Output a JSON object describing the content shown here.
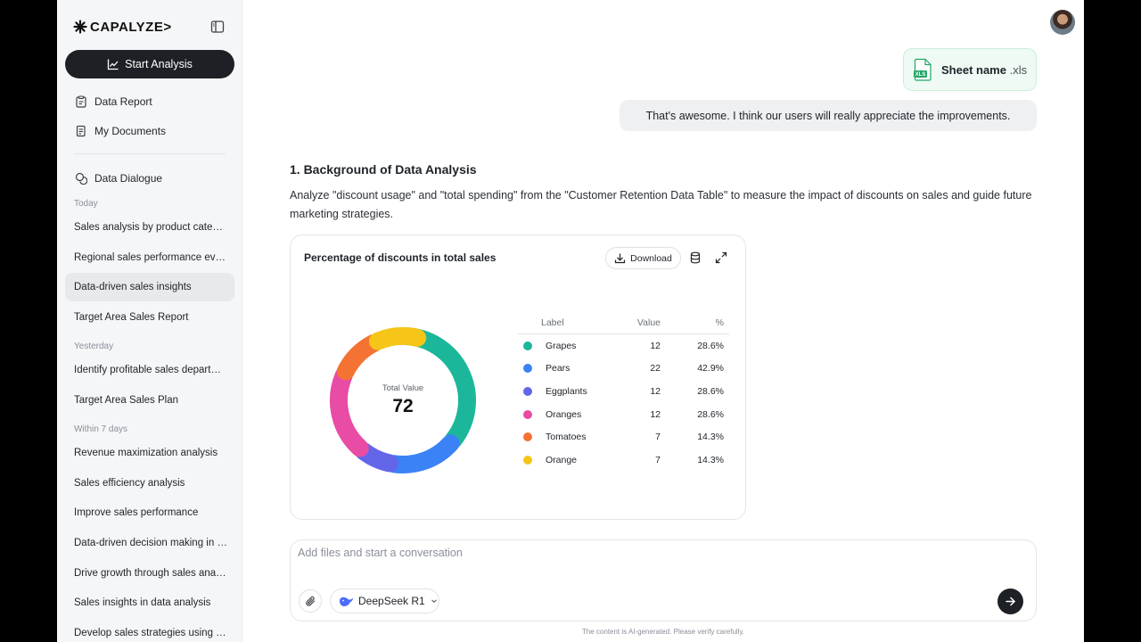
{
  "brand": {
    "name": "CAPALYZE>"
  },
  "sidebar": {
    "start_label": "Start Analysis",
    "nav": [
      {
        "label": "Data Report"
      },
      {
        "label": "My Documents"
      }
    ],
    "dialogue_label": "Data Dialogue",
    "sections": {
      "today": "Today",
      "yesterday": "Yesterday",
      "within7": "Within 7 days"
    },
    "history": [
      "Sales analysis by product category",
      "Regional sales performance evaluation",
      "Data-driven sales insights",
      "Target Area Sales Report",
      "Identify profitable sales departments",
      "Target Area Sales Plan",
      "Revenue maximization analysis",
      "Sales efficiency analysis",
      "Improve sales performance",
      "Data-driven decision making in sales",
      "Drive growth through sales analysis",
      "Sales insights in data analysis",
      "Develop sales strategies using data"
    ]
  },
  "chat": {
    "file": {
      "name": "Sheet name",
      "ext": ".xls",
      "badge": "XLS"
    },
    "user_message": "That's awesome. I think our users will really appreciate the improvements.",
    "answer": {
      "heading": "1. Background of Data Analysis",
      "body": "Analyze \"discount usage\" and \"total spending\" from the \"Customer Retention Data Table\" to measure the impact of discounts on sales and guide future marketing strategies."
    }
  },
  "card": {
    "title": "Percentage of discounts in total sales",
    "download_label": "Download",
    "total_label": "Total Value",
    "total_value": "72",
    "table_headers": {
      "label": "Label",
      "value": "Value",
      "pct": "%"
    }
  },
  "chart_data": {
    "type": "pie",
    "title": "Percentage of discounts in total sales",
    "center_label": "Total Value",
    "center_value": 72,
    "categories": [
      "Grapes",
      "Pears",
      "Eggplants",
      "Oranges",
      "Tomatoes",
      "Orange"
    ],
    "values": [
      12,
      22,
      12,
      12,
      7,
      7
    ],
    "percent_labels": [
      "28.6%",
      "42.9%",
      "28.6%",
      "28.6%",
      "14.3%",
      "14.3%"
    ],
    "colors": [
      "#1cb79b",
      "#3b82f6",
      "#6366e9",
      "#e84ca4",
      "#f47232",
      "#f5c518"
    ],
    "arc_sweeps_deg": [
      130,
      60,
      30,
      75,
      40,
      40
    ]
  },
  "composer": {
    "placeholder": "Add files and start a conversation",
    "model": "DeepSeek R1",
    "disclaimer": "The content is AI-generated. Please verify carefully."
  }
}
